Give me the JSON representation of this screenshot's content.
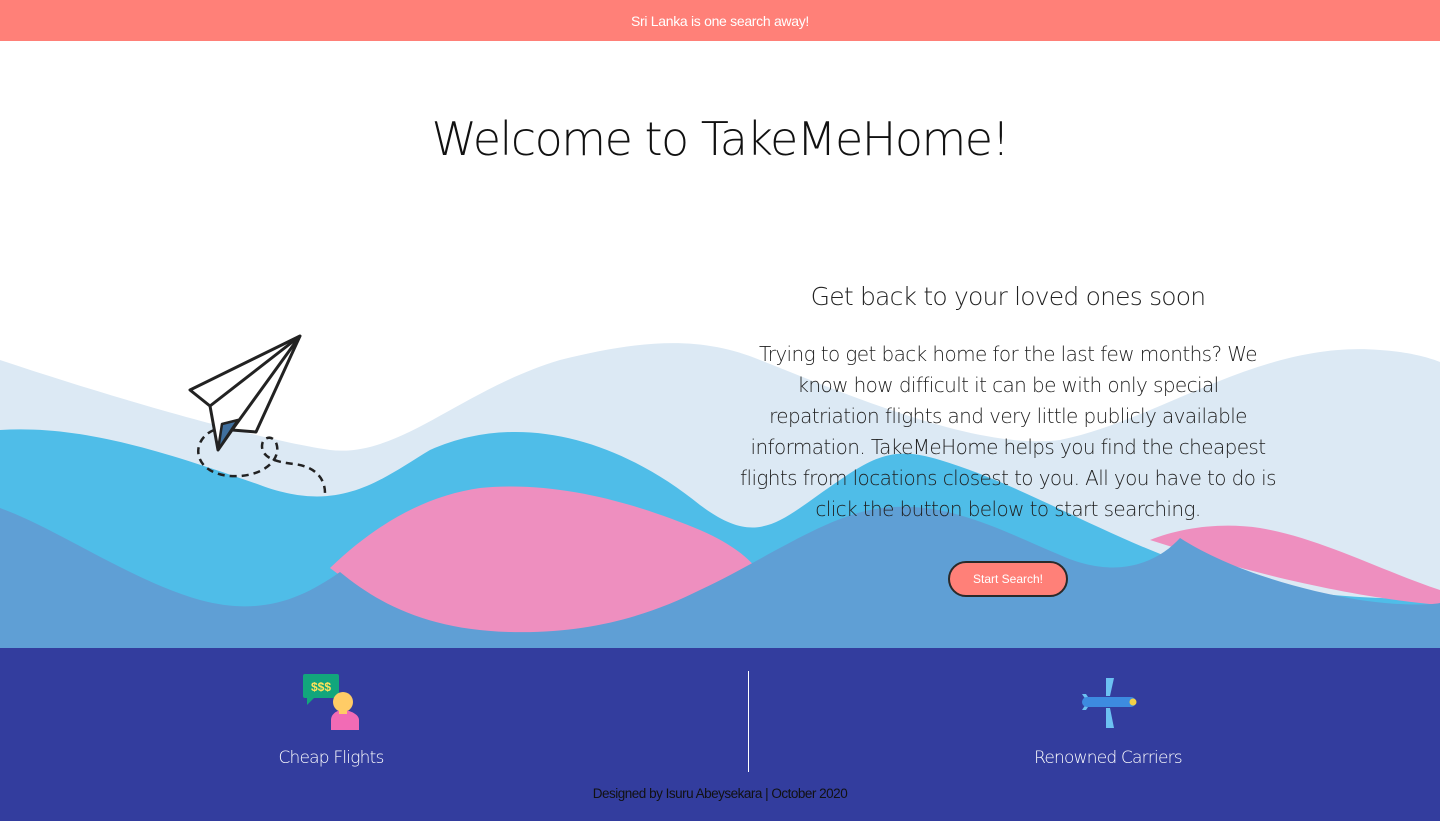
{
  "banner": {
    "text": "Sri Lanka is one search away!"
  },
  "hero": {
    "title": "Welcome to TakeMeHome!",
    "subtitle": "Get back to your loved ones soon",
    "description": "Trying to get back home for the last few months? We know how difficult it can be with only special repatriation flights and very little publicly available information. TakeMeHome helps you find the cheapest flights from locations closest to you. All you have to do is click the button below to start searching.",
    "button_label": "Start Search!",
    "illustration": "paper-plane-icon"
  },
  "features": [
    {
      "label": "Cheap Flights",
      "icon": "money-person-icon",
      "icon_text": "$$$"
    },
    {
      "label": "Renowned Carriers",
      "icon": "airplane-icon"
    }
  ],
  "footer": {
    "credit": "Designed by Isuru Abeysekara | October 2020"
  },
  "colors": {
    "banner": "#ff8078",
    "button": "#ff8078",
    "footer": "#333d9e",
    "wave_light": "#dce9f4",
    "wave_cyan": "#4fbde8",
    "wave_pink": "#ee8fbf",
    "wave_blue": "#5f9fd5"
  }
}
